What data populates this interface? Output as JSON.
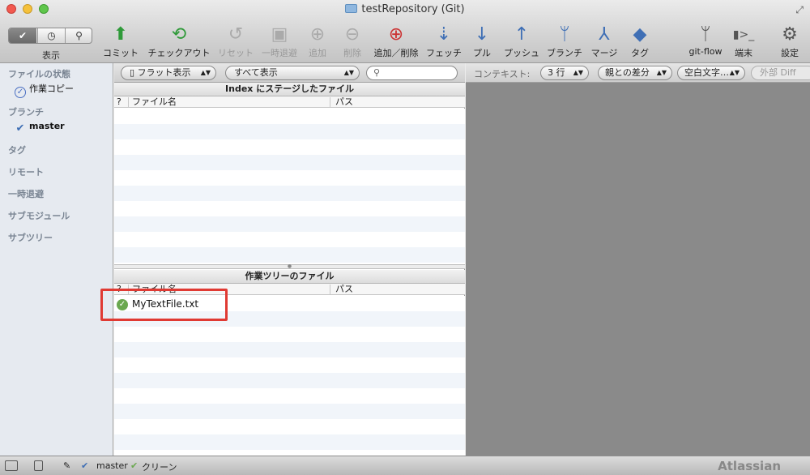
{
  "window": {
    "title": "testRepository (Git)"
  },
  "toolbar": {
    "view_label": "表示",
    "buttons": [
      {
        "label": "コミット",
        "icon": "commit-icon",
        "enabled": true
      },
      {
        "label": "チェックアウト",
        "icon": "checkout-icon",
        "enabled": true
      },
      {
        "label": "リセット",
        "icon": "reset-icon",
        "enabled": false
      },
      {
        "label": "一時退避",
        "icon": "stash-icon",
        "enabled": false
      },
      {
        "label": "追加",
        "icon": "add-icon",
        "enabled": false
      },
      {
        "label": "削除",
        "icon": "remove-icon",
        "enabled": false
      },
      {
        "label": "追加／削除",
        "icon": "add-remove-icon",
        "enabled": true
      },
      {
        "label": "フェッチ",
        "icon": "fetch-icon",
        "enabled": true
      },
      {
        "label": "プル",
        "icon": "pull-icon",
        "enabled": true
      },
      {
        "label": "プッシュ",
        "icon": "push-icon",
        "enabled": true
      },
      {
        "label": "ブランチ",
        "icon": "branch-icon",
        "enabled": true
      },
      {
        "label": "マージ",
        "icon": "merge-icon",
        "enabled": true
      },
      {
        "label": "タグ",
        "icon": "tag-icon",
        "enabled": true
      },
      {
        "label": "git-flow",
        "icon": "git-flow-icon",
        "enabled": true
      },
      {
        "label": "端末",
        "icon": "terminal-icon",
        "enabled": true
      },
      {
        "label": "設定",
        "icon": "settings-gear-icon",
        "enabled": true
      }
    ]
  },
  "sidebar": {
    "file_status": "ファイルの状態",
    "working_copy": "作業コピー",
    "branches": "ブランチ",
    "master": "master",
    "tags": "タグ",
    "remotes": "リモート",
    "stashes": "一時退避",
    "submodules": "サブモジュール",
    "subtrees": "サブツリー"
  },
  "middle": {
    "flat_view": "フラット表示",
    "show_all": "すべて表示",
    "search_placeholder": "",
    "staged_title": "Index にステージしたファイル",
    "unstaged_title": "作業ツリーのファイル",
    "col_status": "?",
    "col_filename": "ファイル名",
    "col_path": "パス",
    "files": [
      {
        "name": "MyTextFile.txt",
        "status": "check-icon"
      }
    ]
  },
  "right": {
    "context_label": "コンテキスト:",
    "context_lines": "3 行",
    "diff_vs_parent": "親との差分",
    "whitespace": "空白文字…",
    "external_diff": "外部 Diff"
  },
  "status": {
    "branch": "master",
    "state": "クリーン",
    "brand": "Atlassian"
  },
  "colors": {
    "highlight": "#e03a33",
    "accent": "#3f6fb5",
    "clean": "#6aa84f"
  }
}
